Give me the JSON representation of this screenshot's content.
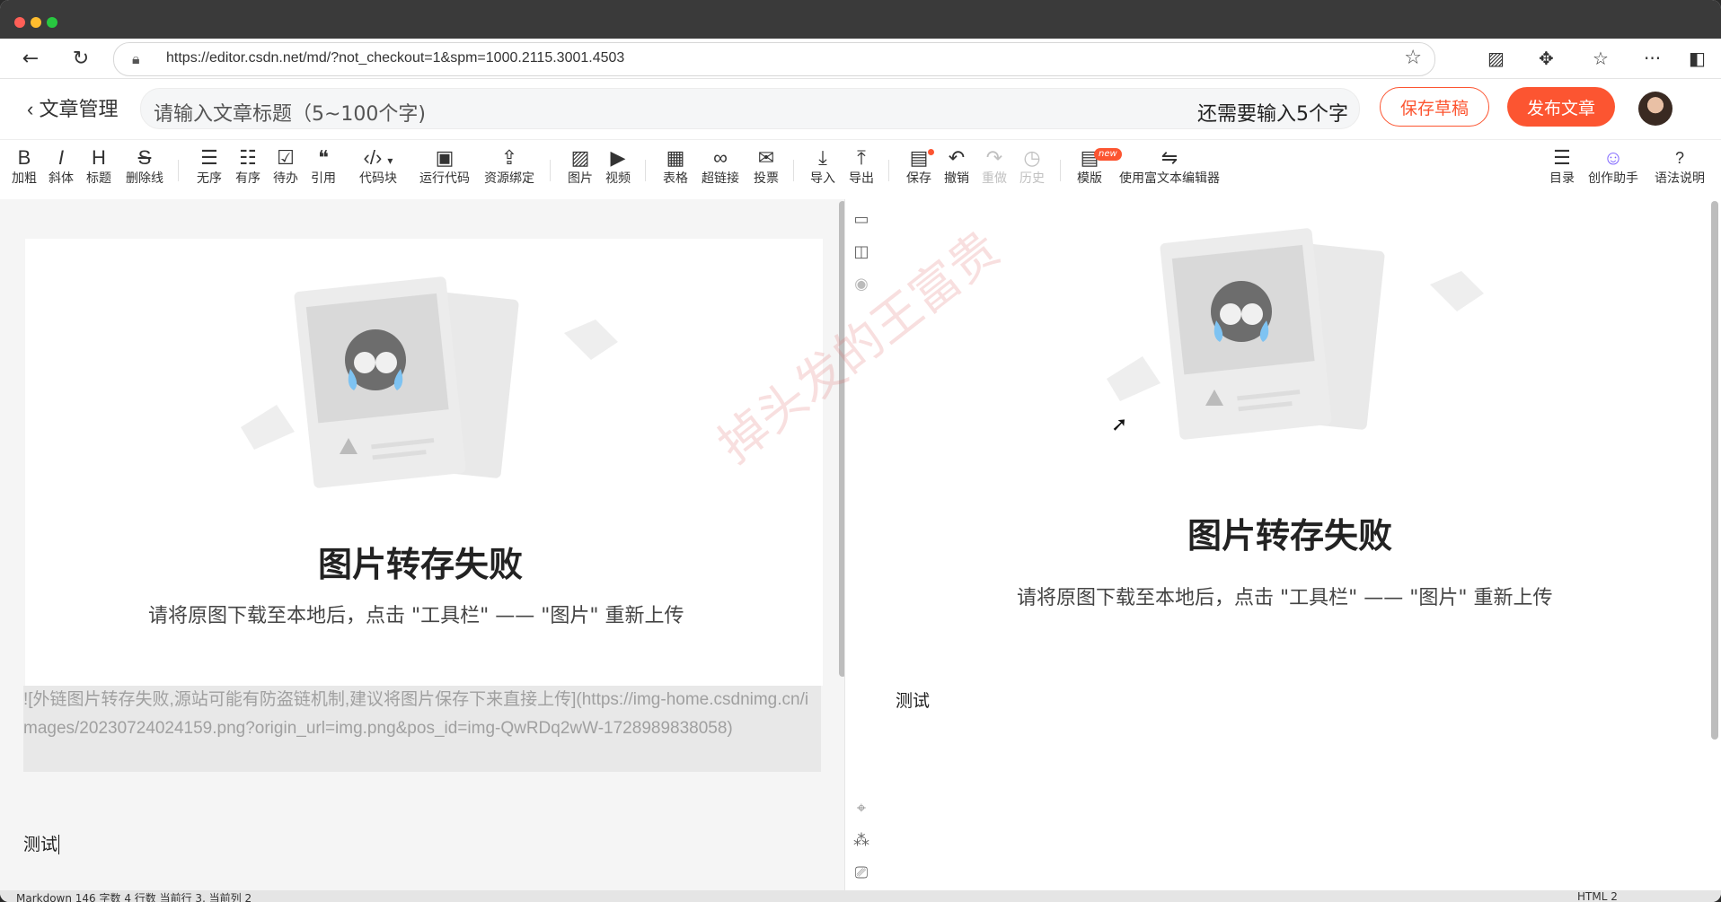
{
  "browser": {
    "url": "https://editor.csdn.net/md/?not_checkout=1&spm=1000.2115.3001.4503",
    "icons": [
      "back-icon",
      "reload-icon",
      "lock-icon",
      "star-icon",
      "extension-icon",
      "puzzle-icon",
      "favorites-icon",
      "more-icon",
      "sidebar-icon"
    ]
  },
  "header": {
    "back_label": "文章管理",
    "title_placeholder": "请输入文章标题（5~100个字)",
    "title_counter": "还需要输入5个字",
    "save_draft_label": "保存草稿",
    "publish_label": "发布文章"
  },
  "toolbar": {
    "bold": {
      "glyph": "B",
      "label": "加粗"
    },
    "italic": {
      "glyph": "I",
      "label": "斜体"
    },
    "heading": {
      "glyph": "H",
      "label": "标题"
    },
    "strike": {
      "glyph": "S",
      "label": "删除线"
    },
    "ul": {
      "glyph": "☰",
      "label": "无序"
    },
    "ol": {
      "glyph": "☷",
      "label": "有序"
    },
    "todo": {
      "glyph": "☑",
      "label": "待办"
    },
    "quote": {
      "glyph": "❝",
      "label": "引用"
    },
    "codeblock": {
      "glyph": "‹/›",
      "label": "代码块"
    },
    "runcode": {
      "glyph": "▣",
      "label": "运行代码"
    },
    "resource": {
      "glyph": "⇪",
      "label": "资源绑定"
    },
    "image": {
      "glyph": "▨",
      "label": "图片"
    },
    "video": {
      "glyph": "▶",
      "label": "视频"
    },
    "table": {
      "glyph": "▦",
      "label": "表格"
    },
    "link": {
      "glyph": "∞",
      "label": "超链接"
    },
    "vote": {
      "glyph": "✉",
      "label": "投票"
    },
    "import": {
      "glyph": "⤓",
      "label": "导入"
    },
    "export": {
      "glyph": "⤒",
      "label": "导出"
    },
    "save": {
      "glyph": "▤",
      "label": "保存"
    },
    "undo": {
      "glyph": "↶",
      "label": "撤销"
    },
    "redo": {
      "glyph": "↷",
      "label": "重做"
    },
    "history": {
      "glyph": "◷",
      "label": "历史"
    },
    "template": {
      "glyph": "▤",
      "label": "模版",
      "badge": "new"
    },
    "richtext": {
      "glyph": "⇋",
      "label": "使用富文本编辑器"
    },
    "toc": {
      "glyph": "☰",
      "label": "目录"
    },
    "assistant": {
      "glyph": "☺",
      "label": "创作助手"
    },
    "syntax": {
      "glyph": "?",
      "label": "语法说明"
    }
  },
  "editor": {
    "fail_title": "图片转存失败",
    "fail_hint": "请将原图下载至本地后，点击 \"工具栏\" —— \"图片\" 重新上传",
    "markdown_line": "![外链图片转存失败,源站可能有防盗链机制,建议将图片保存下来直接上传](https://img-home.csdnimg.cn/images/20230724024159.png?origin_url=img.png&pos_id=img-QwRDq2wW-1728989838058)",
    "body_text": "测试"
  },
  "preview": {
    "fail_title": "图片转存失败",
    "fail_hint": "请将原图下载至本地后，点击 \"工具栏\" —— \"图片\" 重新上传",
    "body_text": "测试"
  },
  "watermark": "掉头发的王富贵",
  "status": {
    "left": "Markdown  146 字数  4 行数  当前行 3, 当前列 2",
    "right": "HTML  2"
  },
  "colors": {
    "accent": "#fc5531"
  }
}
